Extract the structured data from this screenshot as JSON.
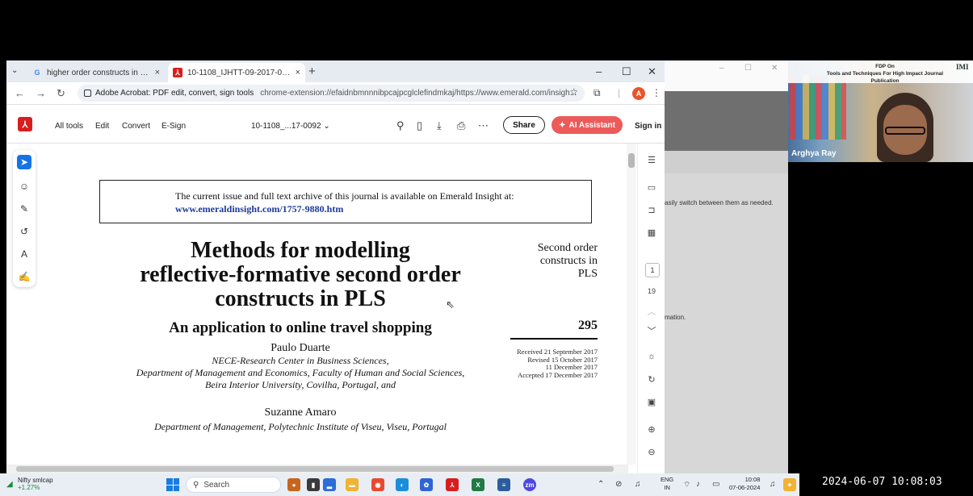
{
  "chrome": {
    "tabs": [
      {
        "label": "higher order constructs in mod",
        "favicon": "G"
      },
      {
        "label": "10-1108_IJHTT-09-2017-0092.p",
        "favicon": "pdf"
      }
    ],
    "tab_close": "×",
    "new_tab": "+",
    "window_controls": {
      "minimize": "–",
      "maximize": "☐",
      "close": "✕"
    },
    "site_label": "Adobe Acrobat: PDF edit, convert, sign tools",
    "url": "chrome-extension://efaidnbmnnnibpcajpcglclefindmkaj/https://www.emerald.com/insigh...",
    "profile_initial": "A"
  },
  "acrobat": {
    "menu": [
      "All tools",
      "Edit",
      "Convert",
      "E-Sign"
    ],
    "doc_name": "10-1108_...17-0092",
    "share_label": "Share",
    "ai_label": "AI Assistant",
    "signin_label": "Sign in",
    "page_current": "1",
    "page_total": "19"
  },
  "paper": {
    "notice_line1": "The current issue and full text archive of this journal is available on Emerald Insight at:",
    "notice_link": "www.emeraldinsight.com/1757-9880.htm",
    "title_lines": [
      "Methods for modelling",
      "reflective-formative second order",
      "constructs in PLS"
    ],
    "subtitle": "An application to online travel shopping",
    "author1": "Paulo Duarte",
    "affil1": [
      "NECE-Research Center in Business Sciences,",
      "Department of Management and Economics, Faculty of Human and Social Sciences,",
      "Beira Interior University, Covilha, Portugal, and"
    ],
    "author2": "Suzanne Amaro",
    "affil2": "Department of Management, Polytechnic Institute of Viseu, Viseu, Portugal",
    "running_head": [
      "Second order",
      "constructs in",
      "PLS"
    ],
    "page_number": "295",
    "dates": [
      "Received 21 September 2017",
      "Revised 15 October 2017",
      "11 December 2017",
      "Accepted 17 December 2017"
    ]
  },
  "bg_window": {
    "text1": "asily switch between them as needed.",
    "text2": "mation."
  },
  "video": {
    "title_line1": "FDP On",
    "title_line2": "Tools and Techniques For High Impact Journal Publication",
    "logo": "IMI",
    "participant": "Arghya Ray"
  },
  "taskbar": {
    "stock_name": "Nifty smlcap",
    "stock_change": "+1.27%",
    "search_label": "Search",
    "lang_line1": "ENG",
    "lang_line2": "IN",
    "time": "10:08",
    "date": "07-06-2024"
  },
  "recording_timestamp": "2024-06-07 10:08:03"
}
